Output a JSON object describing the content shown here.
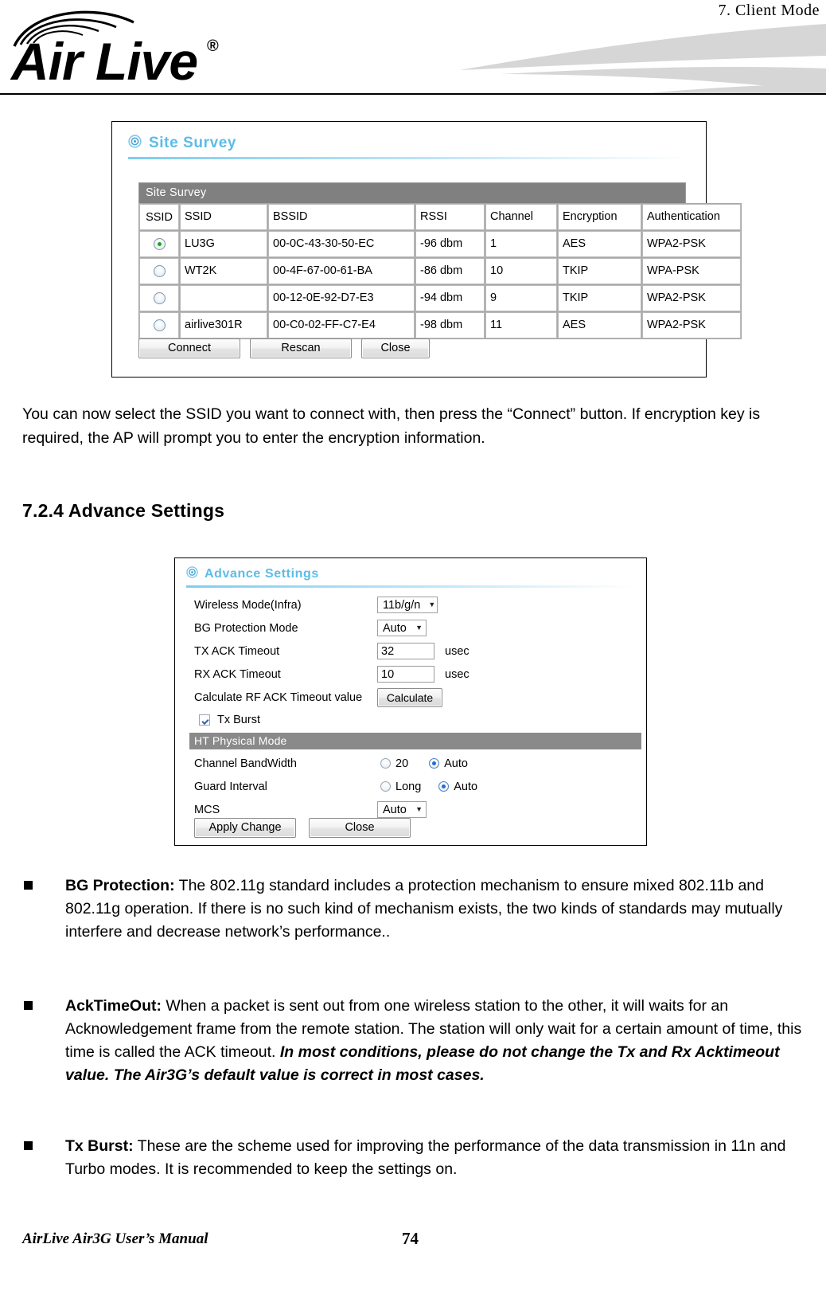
{
  "header": {
    "chapter_label": "7.    Client  Mode",
    "logo_text": "Air Live",
    "logo_registered": "®"
  },
  "site_survey_panel": {
    "title": "Site Survey",
    "title_icon": "target-icon",
    "table_caption": "Site Survey",
    "columns": [
      "SSID",
      "SSID",
      "BSSID",
      "RSSI",
      "Channel",
      "Encryption",
      "Authentication"
    ],
    "rows": [
      {
        "selected": true,
        "ssid": "LU3G",
        "bssid": "00-0C-43-30-50-EC",
        "rssi": "-96 dbm",
        "channel": "1",
        "encryption": "AES",
        "authentication": "WPA2-PSK"
      },
      {
        "selected": false,
        "ssid": "WT2K",
        "bssid": "00-4F-67-00-61-BA",
        "rssi": "-86 dbm",
        "channel": "10",
        "encryption": "TKIP",
        "authentication": "WPA-PSK"
      },
      {
        "selected": false,
        "ssid": "",
        "bssid": "00-12-0E-92-D7-E3",
        "rssi": "-94 dbm",
        "channel": "9",
        "encryption": "TKIP",
        "authentication": "WPA2-PSK"
      },
      {
        "selected": false,
        "ssid": "airlive301R",
        "bssid": "00-C0-02-FF-C7-E4",
        "rssi": "-98 dbm",
        "channel": "11",
        "encryption": "AES",
        "authentication": "WPA2-PSK"
      }
    ],
    "buttons": {
      "connect": "Connect",
      "rescan": "Rescan",
      "close": "Close"
    }
  },
  "intro_paragraph": "You can now select the SSID you want to connect with, then press the “Connect” button.    If encryption key is required, the AP will prompt you to enter the encryption information.",
  "section_heading": "7.2.4 Advance Settings",
  "advance_settings_panel": {
    "title": "Advance Settings",
    "title_icon": "target-icon",
    "fields": {
      "wireless_mode_label": "Wireless Mode(Infra)",
      "wireless_mode_value": "11b/g/n",
      "bg_protection_label": "BG Protection Mode",
      "bg_protection_value": "Auto",
      "tx_ack_label": "TX ACK Timeout",
      "tx_ack_value": "32",
      "tx_ack_unit": "usec",
      "rx_ack_label": "RX ACK Timeout",
      "rx_ack_value": "10",
      "rx_ack_unit": "usec",
      "calculate_label": "Calculate RF ACK Timeout value",
      "calculate_button": "Calculate",
      "tx_burst_label": "Tx Burst",
      "tx_burst_checked": true
    },
    "ht_section_title": "HT Physical Mode",
    "ht_fields": {
      "channel_bandwidth_label": "Channel BandWidth",
      "channel_bandwidth_opt1": "20",
      "channel_bandwidth_opt2": "Auto",
      "channel_bandwidth_selected": "Auto",
      "guard_interval_label": "Guard Interval",
      "guard_interval_opt1": "Long",
      "guard_interval_opt2": "Auto",
      "guard_interval_selected": "Auto",
      "mcs_label": "MCS",
      "mcs_value": "Auto"
    },
    "buttons": {
      "apply": "Apply Change",
      "close": "Close"
    }
  },
  "bullets": {
    "bg_protection": {
      "term": "BG Protection:",
      "body": "  The 802.11g standard includes a protection mechanism to ensure mixed 802.11b and 802.11g operation. If there is no such kind of mechanism exists, the two kinds of standards may mutually interfere and decrease network’s performance.."
    },
    "ack_timeout": {
      "term": "AckTimeOut:",
      "body": "  When a packet is sent out from one wireless station to the other, it will waits for an Acknowledgement frame from the remote station.    The station will only wait for a certain amount of time, this time is called the ACK timeout.  ",
      "emphasis": "In most conditions, please do not change the Tx and Rx Acktimeout value.    The Air3G’s default value is correct in most cases."
    },
    "tx_burst": {
      "term": "Tx Burst:",
      "body": "  These are the scheme used for improving the performance of the data transmission in 11n and Turbo modes.    It is recommended to keep the settings on."
    }
  },
  "footer": {
    "manual_title": "AirLive Air3G User’s Manual",
    "page_number": "74"
  },
  "colors": {
    "panel_title_blue": "#5CBCE8",
    "table_header_gray": "#808080",
    "ht_bar_gray": "#8A8A8A",
    "radio_selected_green": "#17A81A",
    "radio_selected_blue": "#1F6FD0"
  }
}
